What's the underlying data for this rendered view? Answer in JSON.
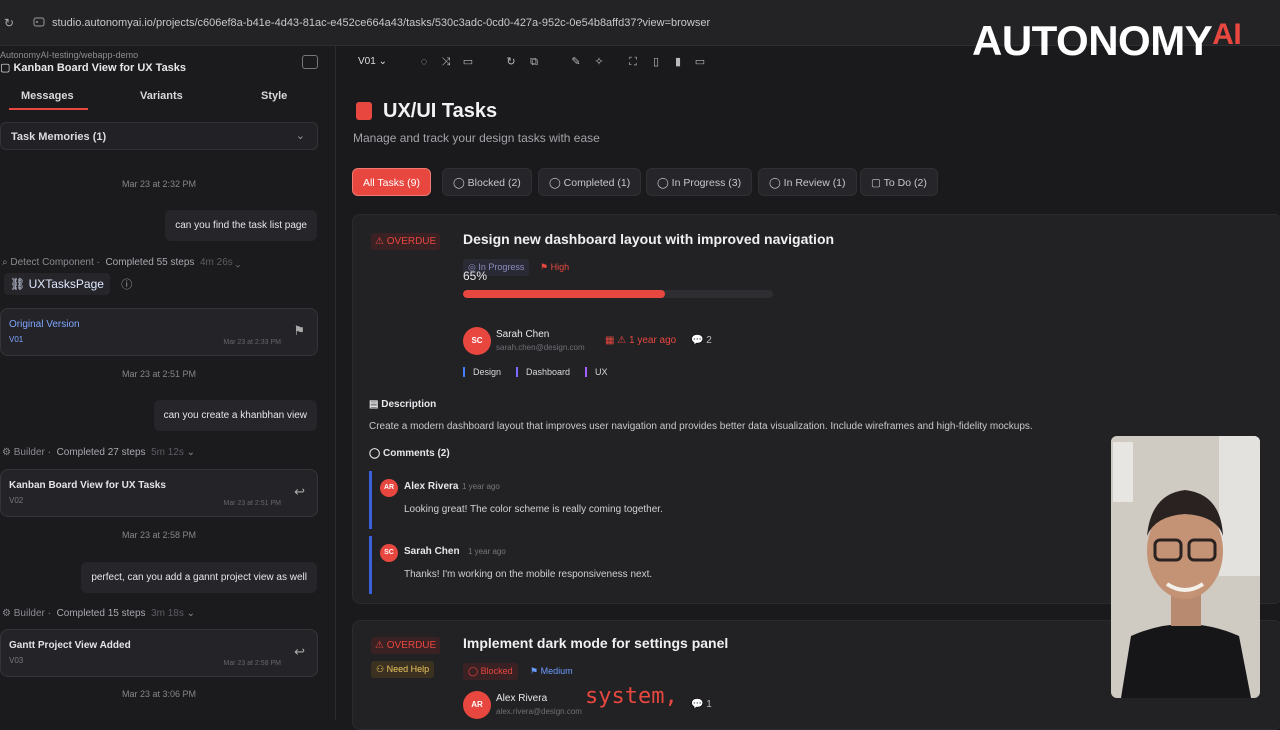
{
  "browser": {
    "url": "studio.autonomyai.io/projects/c606ef8a-b41e-4d43-81ac-e452ce664a43/tasks/530c3adc-0cd0-427a-952c-0e54b8affd37?view=browser"
  },
  "brand": {
    "name": "AUTONOMY",
    "suffix": "AI"
  },
  "sidebar": {
    "project": "AutonomyAI-testing/webapp-demo",
    "page_name": "Kanban Board View for UX Tasks",
    "tabs": [
      "Messages",
      "Variants",
      "Style"
    ],
    "memories": "Task Memories (1)",
    "timestamps": [
      "Mar 23 at 2:32 PM",
      "Mar 23 at 2:51 PM",
      "Mar 23 at 2:58 PM",
      "Mar 23 at 3:06 PM"
    ],
    "messages": [
      "can you find the task list page",
      "can you create a khanbhan view",
      "perfect, can you add a gannt project view as well"
    ],
    "steps": [
      {
        "agent": "Detect Component",
        "status": "Completed 55 steps",
        "time": "4m 26s"
      },
      {
        "agent": "Builder",
        "status": "Completed 27 steps",
        "time": "5m 12s"
      },
      {
        "agent": "Builder",
        "status": "Completed 15 steps",
        "time": "3m 18s"
      }
    ],
    "component": "UXTasksPage",
    "versions": [
      {
        "title": "Original Version",
        "version": "V01",
        "date": "Mar 23 at 2:33 PM"
      },
      {
        "title": "Kanban Board View for UX Tasks",
        "version": "V02",
        "date": "Mar 23 at 2:51 PM"
      },
      {
        "title": "Gantt Project View Added",
        "version": "V03",
        "date": "Mar 23 at 2:58 PM"
      }
    ]
  },
  "toolbar": {
    "version": "V01 ⌄"
  },
  "main": {
    "title": "UX/UI Tasks",
    "subtitle": "Manage and track your design tasks with ease",
    "filters": [
      "All Tasks (9)",
      "Blocked (2)",
      "Completed (1)",
      "In Progress (3)",
      "In Review (1)",
      "To Do (2)"
    ],
    "task1": {
      "badge": "⚠ OVERDUE",
      "title": "Design new dashboard layout with improved navigation",
      "status": "In Progress",
      "priority": "High",
      "progress_label": "65%",
      "progress": 0.65,
      "assignee": {
        "initials": "SC",
        "name": "Sarah Chen",
        "email": "sarah.chen@design.com"
      },
      "due": "⚠ 1 year ago",
      "comments_count": "2",
      "tags": [
        "Design",
        "Dashboard",
        "UX"
      ],
      "description_label": "Description",
      "description": "Create a modern dashboard layout that improves user navigation and provides better data visualization. Include wireframes and high-fidelity mockups.",
      "comments_label": "Comments (2)",
      "comments": [
        {
          "initials": "AR",
          "name": "Alex Rivera",
          "time": "1 year ago",
          "text": "Looking great! The color scheme is really coming together."
        },
        {
          "initials": "SC",
          "name": "Sarah Chen",
          "time": "1 year ago",
          "text": "Thanks! I'm working on the mobile responsiveness next."
        }
      ]
    },
    "task2": {
      "badge": "⚠ OVERDUE",
      "title": "Implement dark mode for settings panel",
      "help": "Need Help",
      "status": "Blocked",
      "priority": "Medium",
      "assignee": {
        "initials": "AR",
        "name": "Alex Rivera",
        "email": "alex.rivera@design.com"
      },
      "comments_count": "1"
    }
  },
  "caption": "system,"
}
